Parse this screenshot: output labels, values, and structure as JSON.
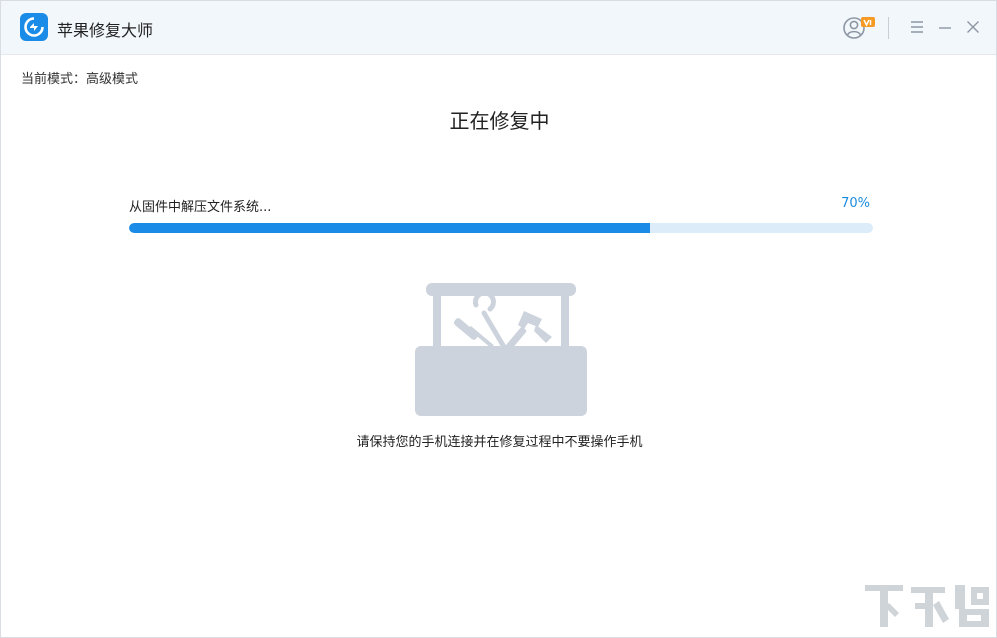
{
  "window": {
    "title": "苹果修复大师",
    "icons": {
      "logo": "app-logo-icon",
      "user": "user-vip-icon",
      "menu": "menu-icon",
      "minimize": "minimize-icon",
      "close": "close-icon"
    }
  },
  "mode": {
    "label": "当前模式：",
    "value": "高级模式"
  },
  "main": {
    "heading": "正在修复中",
    "progress": {
      "status": "从固件中解压文件系统...",
      "percent_text": "70%",
      "fraction": 0.7
    },
    "illustration": "toolbox-icon",
    "hint": "请保持您的手机连接并在修复过程中不要操作手机"
  },
  "colors": {
    "accent": "#1a8ce8",
    "track": "#ddecf9",
    "titlebar": "#f2f7fc",
    "toolbox": "#cdd3dc",
    "vip_badge": "#f59a23"
  }
}
